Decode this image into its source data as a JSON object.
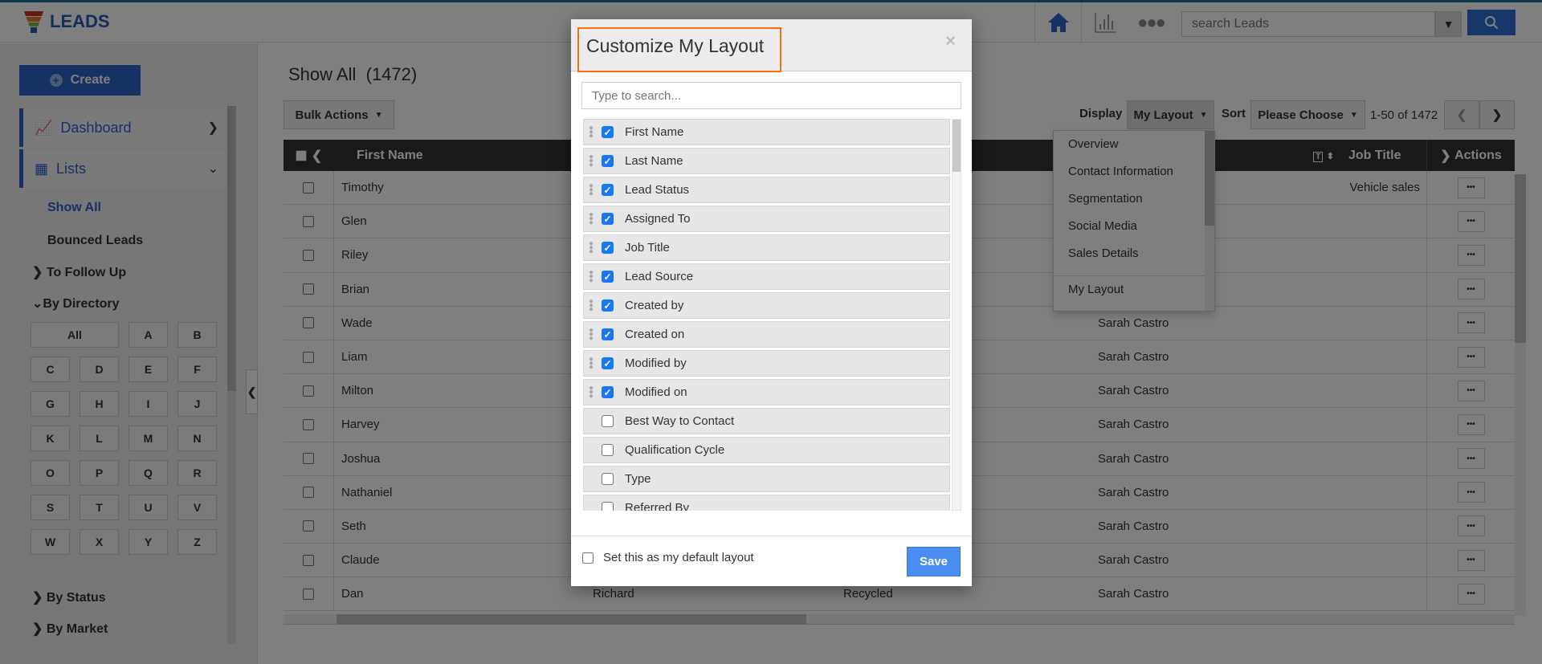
{
  "app": {
    "title": "LEADS"
  },
  "topbar": {
    "search_placeholder": "search Leads",
    "icons": [
      "home-icon",
      "bar-chart-icon",
      "more-icon",
      "chevron-down-icon",
      "search-icon"
    ]
  },
  "sidebar": {
    "create_label": "Create",
    "nav": [
      {
        "label": "Dashboard",
        "icon": "line-chart-icon"
      },
      {
        "label": "Lists",
        "icon": "calendar-grid-icon"
      }
    ],
    "lists": {
      "show_all": "Show All",
      "bounced": "Bounced Leads",
      "to_follow_up": "To Follow Up",
      "by_directory": "By Directory",
      "by_status": "By Status",
      "by_market": "By Market"
    },
    "letters": [
      "All",
      "A",
      "B",
      "C",
      "D",
      "E",
      "F",
      "G",
      "H",
      "I",
      "J",
      "K",
      "L",
      "M",
      "N",
      "O",
      "P",
      "Q",
      "R",
      "S",
      "T",
      "U",
      "V",
      "W",
      "X",
      "Y",
      "Z"
    ]
  },
  "main": {
    "title": "Show All",
    "count": "(1472)",
    "bulk_actions": "Bulk Actions",
    "display_label": "Display",
    "display_value": "My Layout",
    "sort_label": "Sort",
    "sort_value": "Please Choose",
    "pagination": "1-50 of 1472",
    "columns": {
      "first_name": "First Name",
      "job_title": "Job Title",
      "actions": "Actions"
    },
    "rows": [
      {
        "first": "Timothy",
        "last": "",
        "status": "",
        "assigned": "",
        "job": "Vehicle sales"
      },
      {
        "first": "Glen",
        "last": "",
        "status": "",
        "assigned": "",
        "job": ""
      },
      {
        "first": "Riley",
        "last": "",
        "status": "",
        "assigned": "",
        "job": ""
      },
      {
        "first": "Brian",
        "last": "",
        "status": "",
        "assigned": "",
        "job": ""
      },
      {
        "first": "Wade",
        "last": "",
        "status": "",
        "assigned": "Sarah Castro",
        "job": ""
      },
      {
        "first": "Liam",
        "last": "",
        "status": "",
        "assigned": "Sarah Castro",
        "job": ""
      },
      {
        "first": "Milton",
        "last": "",
        "status": "",
        "assigned": "Sarah Castro",
        "job": ""
      },
      {
        "first": "Harvey",
        "last": "",
        "status": "",
        "assigned": "Sarah Castro",
        "job": ""
      },
      {
        "first": "Joshua",
        "last": "",
        "status": "",
        "assigned": "Sarah Castro",
        "job": ""
      },
      {
        "first": "Nathaniel",
        "last": "",
        "status": "",
        "assigned": "Sarah Castro",
        "job": ""
      },
      {
        "first": "Seth",
        "last": "",
        "status": "",
        "assigned": "Sarah Castro",
        "job": ""
      },
      {
        "first": "Claude",
        "last": "",
        "status": "",
        "assigned": "Sarah Castro",
        "job": ""
      },
      {
        "first": "Dan",
        "last": "Richard",
        "status": "Recycled",
        "assigned": "Sarah Castro",
        "job": ""
      }
    ]
  },
  "display_dropdown": {
    "items": [
      "Overview",
      "Contact Information",
      "Segmentation",
      "Social Media",
      "Sales Details"
    ],
    "custom": "My Layout"
  },
  "modal": {
    "title": "Customize My Layout",
    "close": "×",
    "search_placeholder": "Type to search...",
    "fields": [
      {
        "label": "First Name",
        "checked": true
      },
      {
        "label": "Last Name",
        "checked": true
      },
      {
        "label": "Lead Status",
        "checked": true
      },
      {
        "label": "Assigned To",
        "checked": true
      },
      {
        "label": "Job Title",
        "checked": true
      },
      {
        "label": "Lead Source",
        "checked": true
      },
      {
        "label": "Created by",
        "checked": true
      },
      {
        "label": "Created on",
        "checked": true
      },
      {
        "label": "Modified by",
        "checked": true
      },
      {
        "label": "Modified on",
        "checked": true
      },
      {
        "label": "Best Way to Contact",
        "checked": false
      },
      {
        "label": "Qualification Cycle",
        "checked": false
      },
      {
        "label": "Type",
        "checked": false
      },
      {
        "label": "Referred By",
        "checked": false
      }
    ],
    "default_label": "Set this as my default layout",
    "save": "Save"
  },
  "colors": {
    "brand": "#2f62c8",
    "highlight": "#ff6a13",
    "checkbox": "#1877f2",
    "save": "#4a8cf0",
    "header": "#333333"
  }
}
